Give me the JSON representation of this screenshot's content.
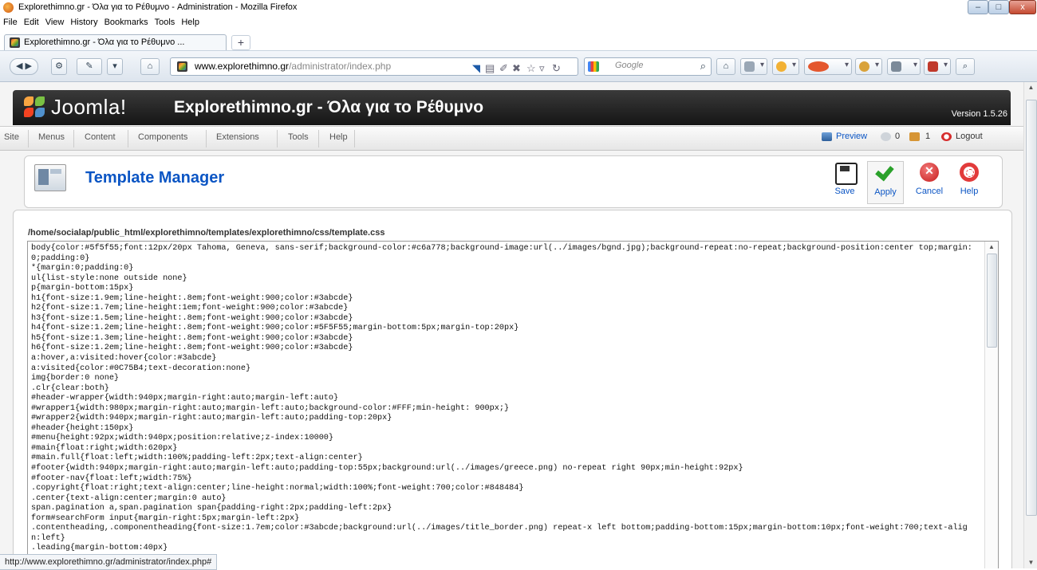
{
  "window": {
    "title": "Explorethimno.gr - Όλα για το Ρέθυμνο - Administration - Mozilla Firefox",
    "minimize": "–",
    "maximize": "□",
    "close": "x"
  },
  "menubar": [
    "File",
    "Edit",
    "View",
    "History",
    "Bookmarks",
    "Tools",
    "Help"
  ],
  "tab": {
    "label": "Explorethimno.gr - Όλα για το Ρέθυμνο ...",
    "new_tab": "+"
  },
  "navbar": {
    "url_domain": "www.explorethimno.gr",
    "url_path": "/administrator/index.php",
    "search_placeholder": "Google"
  },
  "joomla": {
    "brand": "Joomla!",
    "site_title": "Explorethimno.gr - Όλα για το Ρέθυμνο",
    "version": "Version 1.5.26",
    "menu": [
      "Site",
      "Menus",
      "Content",
      "Components",
      "Extensions",
      "Tools",
      "Help"
    ],
    "status": {
      "preview": "Preview",
      "messages": "0",
      "users": "1",
      "logout": "Logout"
    }
  },
  "toolbar": {
    "title": "Template Manager",
    "save": "Save",
    "apply": "Apply",
    "cancel": "Cancel",
    "help": "Help"
  },
  "editor": {
    "file_path": "/home/socialap/public_html/explorethimno/templates/explorethimno/css/template.css",
    "css": "body{color:#5f5f55;font:12px/20px Tahoma, Geneva, sans-serif;background-color:#c6a778;background-image:url(../images/bgnd.jpg);background-repeat:no-repeat;background-position:center top;margin:0;padding:0}\n*{margin:0;padding:0}\nul{list-style:none outside none}\np{margin-bottom:15px}\nh1{font-size:1.9em;line-height:.8em;font-weight:900;color:#3abcde}\nh2{font-size:1.7em;line-height:1em;font-weight:900;color:#3abcde}\nh3{font-size:1.5em;line-height:.8em;font-weight:900;color:#3abcde}\nh4{font-size:1.2em;line-height:.8em;font-weight:900;color:#5F5F55;margin-bottom:5px;margin-top:20px}\nh5{font-size:1.3em;line-height:.8em;font-weight:900;color:#3abcde}\nh6{font-size:1.2em;line-height:.8em;font-weight:900;color:#3abcde}\na:hover,a:visited:hover{color:#3abcde}\na:visited{color:#0C75B4;text-decoration:none}\nimg{border:0 none}\n.clr{clear:both}\n#header-wrapper{width:940px;margin-right:auto;margin-left:auto}\n#wrapper1{width:980px;margin-right:auto;margin-left:auto;background-color:#FFF;min-height: 900px;}\n#wrapper2{width:940px;margin-right:auto;margin-left:auto;padding-top:20px}\n#header{height:150px}\n#menu{height:92px;width:940px;position:relative;z-index:10000}\n#main{float:right;width:620px}\n#main.full{float:left;width:100%;padding-left:2px;text-align:center}\n#footer{width:940px;margin-right:auto;margin-left:auto;padding-top:55px;background:url(../images/greece.png) no-repeat right 90px;min-height:92px}\n#footer-nav{float:left;width:75%}\n.copyright{float:right;text-align:center;line-height:normal;width:100%;font-weight:700;color:#848484}\n.center{text-align:center;margin:0 auto}\nspan.pagination a,span.pagination span{padding-right:2px;padding-left:2px}\nform#searchForm input{margin-right:5px;margin-left:2px}\n.contentheading,.componentheading{font-size:1.7em;color:#3abcde;background:url(../images/title_border.png) repeat-x left bottom;padding-bottom:15px;margin-bottom:10px;font-weight:700;text-align:left}\n.leading{margin-bottom:40px}"
  },
  "statusbar": {
    "text": "http://www.explorethimno.gr/administrator/index.php#"
  },
  "colors": {
    "joomla_link": "#0b55c4",
    "header_dark": "#1b1b1b"
  }
}
